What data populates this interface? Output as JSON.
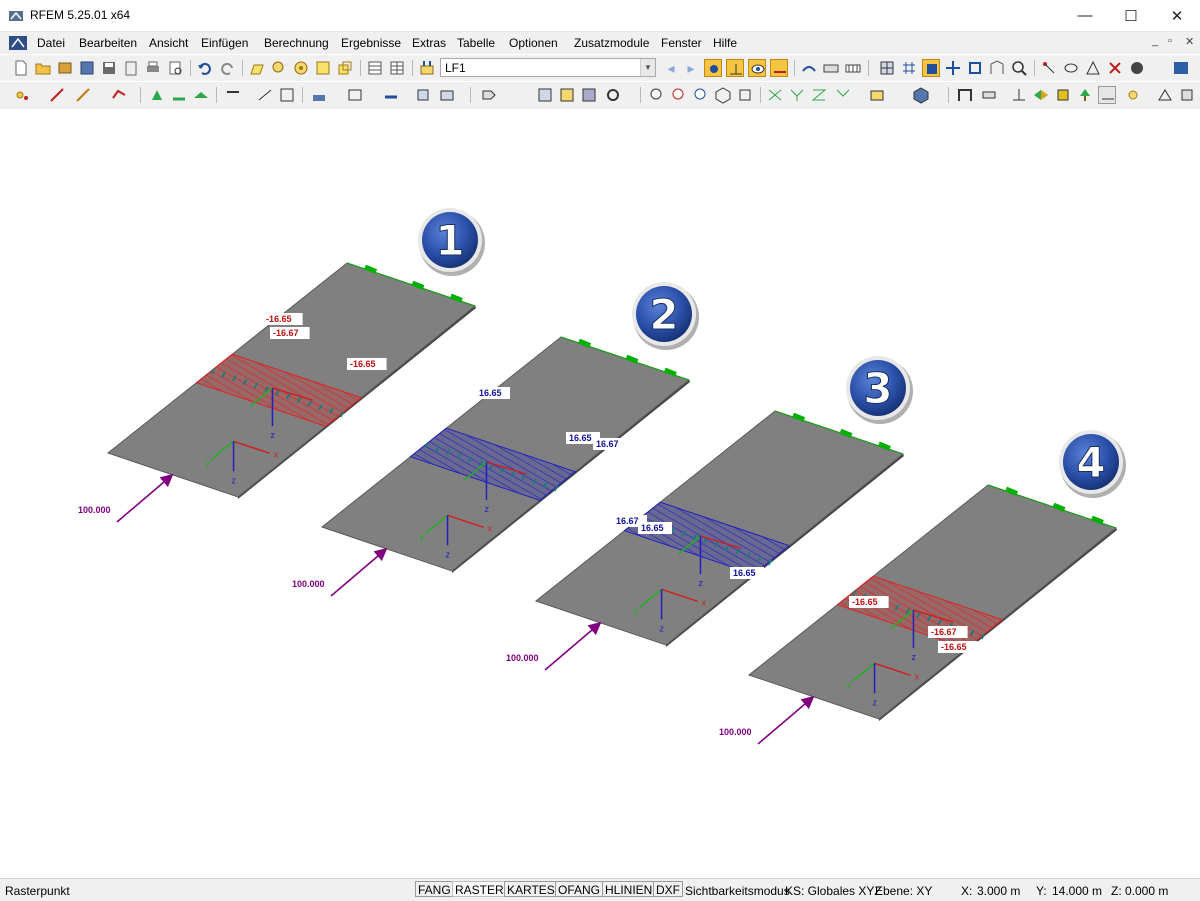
{
  "window": {
    "title": "RFEM 5.25.01 x64",
    "controls": {
      "minimize": "—",
      "maximize": "☐",
      "close": "✕"
    }
  },
  "menu": {
    "items": [
      "Datei",
      "Bearbeiten",
      "Ansicht",
      "Einfügen",
      "Berechnung",
      "Ergebnisse",
      "Extras",
      "Tabelle",
      "Optionen",
      "Zusatzmodule",
      "Fenster",
      "Hilfe"
    ],
    "mdi_controls": {
      "minimize": "_",
      "restore": "▫",
      "close": "✕"
    }
  },
  "toolbar": {
    "loadcase_value": "LF1",
    "nav_prev": "◂",
    "nav_next": "▸"
  },
  "model": {
    "panels": [
      {
        "number": "1",
        "load_value": "100.000",
        "result_color": "#e02020",
        "labels": [
          "-16.65",
          "-16.67",
          "-16.65"
        ]
      },
      {
        "number": "2",
        "load_value": "100.000",
        "result_color": "#2020c0",
        "labels": [
          "16.65",
          "16.65",
          "16.67"
        ]
      },
      {
        "number": "3",
        "load_value": "100.000",
        "result_color": "#2020c0",
        "labels": [
          "16.67",
          "16.65",
          "16.65"
        ]
      },
      {
        "number": "4",
        "load_value": "100.000",
        "result_color": "#e02020",
        "labels": [
          "-16.65",
          "-16.67",
          "-16.65"
        ]
      }
    ],
    "axis_labels": {
      "x": "x",
      "y": "y",
      "z": "z"
    }
  },
  "status": {
    "mode_text": "Rasterpunkt",
    "buttons": [
      {
        "label": "FANG",
        "active": false
      },
      {
        "label": "RASTER",
        "active": true
      },
      {
        "label": "KARTES",
        "active": false
      },
      {
        "label": "OFANG",
        "active": false
      },
      {
        "label": "HLINIEN",
        "active": false
      },
      {
        "label": "DXF",
        "active": false
      }
    ],
    "visibility": "Sichtbarkeitsmodus",
    "coordinate_system": "KS: Globales XYZ",
    "plane": "Ebene: XY",
    "x_label": "X:",
    "x_value": "3.000 m",
    "y_label": "Y:",
    "y_value": "14.000 m",
    "z_label": "Z:",
    "z_value": "0.000 m"
  },
  "colors": {
    "slab": "#808080",
    "support": "#00b000",
    "load_arrow": "#800080",
    "badge": "#2a4fa8"
  }
}
